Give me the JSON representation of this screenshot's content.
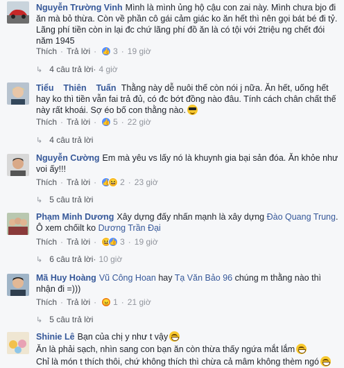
{
  "colors": {
    "author": "#365899",
    "meta": "#90949c",
    "like": "#5890ff",
    "haha": "#f7b928",
    "angry": "#e9710f"
  },
  "comments": [
    {
      "author": "Nguyễn Trường Vinh",
      "text": "Mình là mình ủng hộ cậu con zai này. Mình chưa bjo đi ăn mà bỏ thừa. Còn về phần cô gái cảm giác ko ăn hết thì nên gọi bát bé đi tỷ. Lãng phí tiền còn in lại đc chứ lãng phí đồ ăn là có tội với 2triệu ng chết đói năm 1945",
      "like": "Thích",
      "reply": "Trả lời",
      "reaction_count": "3",
      "time": "19 giờ",
      "replies": "4 câu trả lời",
      "replies_time": "4 giờ",
      "avatar": "avatar-red-car"
    },
    {
      "author": "Tiểu    Thiên    Tuấn",
      "text": "Thằng này dễ nuôi thế còn nói j nữa. Ăn hết, uống hết hay ko thì tiền vẫn fai trả đủ, có đc bớt đồng nào đâu. Tính cách chân chất thế này rất khoái. Sợ éo bố con thằng nào.",
      "like": "Thích",
      "reply": "Trả lời",
      "reaction_count": "5",
      "time": "22 giờ",
      "replies": "4 câu trả lời",
      "replies_time": "",
      "avatar": "avatar-blond"
    },
    {
      "author": "Nguyễn Cường",
      "text": "Em mà yêu vs lấy nó là khuynh gia bại sản đóa. Ăn khỏe như voi ấy!!!",
      "like": "Thích",
      "reply": "Trả lời",
      "reaction_count": "2",
      "time": "23 giờ",
      "replies": "5 câu trả lời",
      "replies_time": "",
      "avatar": "avatar-man"
    },
    {
      "author": "Phạm Minh Dương",
      "text_a": "Xây dựng đấy nhấn mạnh là xây dựng",
      "mention_a": "Đào Quang Trung",
      "text_b": ". Ô xem chốilt ko",
      "mention_b": "Dương Trần Đại",
      "like": "Thích",
      "reply": "Trả lời",
      "reaction_count": "3",
      "time": "19 giờ",
      "replies": "6 câu trả lời",
      "replies_time": "10 giờ",
      "avatar": "avatar-group"
    },
    {
      "author": "Mã Huy Hoàng",
      "mention_a": "Vũ Công Hoan",
      "text_a": "hay",
      "mention_b": "Tạ Văn Bảo 96",
      "text_b": "chúng m thằng nào thì nhận đi =)))",
      "like": "Thích",
      "reply": "Trả lời",
      "reaction_count": "1",
      "time": "21 giờ",
      "replies": "5 câu trả lời",
      "replies_time": "",
      "avatar": "avatar-man2"
    },
    {
      "author": "Shinie Lê",
      "line1": "Bạn của chị y như t vậy",
      "line2": "Ăn là phải sạch, nhìn sang con bạn ăn còn thừa thấy ngứa mắt lắm",
      "line3": "Chỉ là món t thích thôi, chứ không thích thì chừa cả mâm không thèm ngó",
      "avatar": "avatar-toys"
    }
  ]
}
